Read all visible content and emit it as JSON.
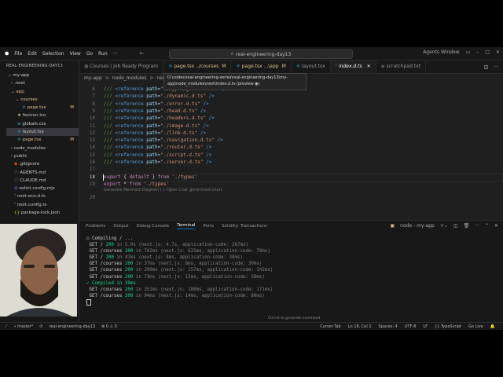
{
  "titlebar": {
    "menu": [
      "File",
      "Edit",
      "Selection",
      "View",
      "Go",
      "Run"
    ],
    "more": "···",
    "command_center": "real-engineering-day13",
    "agents": "Agents Window"
  },
  "sidebar": {
    "header": "REAL-ENGINEERING-DAY13",
    "items": [
      {
        "label": "my-app",
        "mod": ""
      },
      {
        "label": ".next",
        "mod": ""
      },
      {
        "label": "app",
        "mod": ""
      },
      {
        "label": "courses",
        "mod": ""
      },
      {
        "label": "page.tsx",
        "mod": "M"
      },
      {
        "label": "favicon.ico",
        "mod": ""
      },
      {
        "label": "globals.css",
        "mod": ""
      },
      {
        "label": "layout.tsx",
        "mod": ""
      },
      {
        "label": "page.tsx",
        "mod": "M"
      },
      {
        "label": "node_modules",
        "mod": ""
      },
      {
        "label": "public",
        "mod": ""
      },
      {
        "label": ".gitignore",
        "mod": ""
      },
      {
        "label": "AGENTS.md",
        "mod": ""
      },
      {
        "label": "CLAUDE.md",
        "mod": ""
      },
      {
        "label": "eslint.config.mjs",
        "mod": ""
      },
      {
        "label": "next-env.d.ts",
        "mod": ""
      },
      {
        "label": "next.config.ts",
        "mod": ""
      },
      {
        "label": "package-lock.json",
        "mod": ""
      }
    ]
  },
  "tabs": [
    {
      "label": "Courses | Job Ready Program",
      "mod": ""
    },
    {
      "label": "page.tsx ../courses",
      "mod": "M"
    },
    {
      "label": "page.tsx ...\\app",
      "mod": "M"
    },
    {
      "label": "layout.tsx",
      "mod": ""
    },
    {
      "label": "index.d.ts",
      "mod": ""
    },
    {
      "label": "scratchpad.txt",
      "mod": ""
    }
  ],
  "breadcrumb": [
    "my-app",
    ">",
    "node_modules",
    ">",
    "next",
    ">",
    "ty"
  ],
  "tooltip": "D:\\codes\\real-engineering-series\\real-engineering-day13\\my-app\\node_modules\\next\\index.d.ts (preview ◉)",
  "code": [
    {
      "n": "6",
      "path": "./types/global.d.ts"
    },
    {
      "n": "7",
      "path": "./dynamic.d.ts"
    },
    {
      "n": "8",
      "path": "./error.d.ts"
    },
    {
      "n": "9",
      "path": "./head.d.ts"
    },
    {
      "n": "10",
      "path": "./headers.d.ts"
    },
    {
      "n": "11",
      "path": "./image.d.ts"
    },
    {
      "n": "12",
      "path": "./link.d.ts"
    },
    {
      "n": "13",
      "path": "./navigation.d.ts"
    },
    {
      "n": "14",
      "path": "./router.d.ts"
    },
    {
      "n": "15",
      "path": "./script.d.ts"
    },
    {
      "n": "16",
      "path": "./server.d.ts"
    }
  ],
  "code_tail": {
    "l17": "17",
    "l18": "18",
    "l19": "19",
    "l20": "20",
    "export1_a": "export",
    "export1_b": " { ",
    "export1_c": "default",
    "export1_d": " } ",
    "export1_e": "from",
    "export1_f": " './types'",
    "export2_a": "export",
    "export2_b": " * ",
    "export2_c": "from",
    "export2_d": " './types'",
    "lens": "Generate Mermaid Diagram | ◇ Open Chat @mermaid-chart",
    "ref_kw": "/// ",
    "ref_tag": "<reference ",
    "ref_attr": "path=",
    "ref_end": " />"
  },
  "panel": {
    "tabs": [
      "Problems",
      "Output",
      "Debug Console",
      "Terminal",
      "Ports",
      "Solidity: Transactions"
    ],
    "active": "Terminal",
    "terminal_name": "node - my-app",
    "hint": "Ctrl+K to generate command"
  },
  "terminal": [
    {
      "pre": "○ Compiling / ...",
      "status": "",
      "rest": ""
    },
    {
      "pre": " GET / ",
      "status": "200",
      "rest": " in 5.0s (next.js: 4.7s, application-code: 287ms)"
    },
    {
      "pre": " GET /courses ",
      "status": "200",
      "rest": " in 702ms (next.js: 625ms, application-code: 78ms)"
    },
    {
      "pre": " GET / ",
      "status": "200",
      "rest": " in 47ms (next.js: 8ms, application-code: 38ms)"
    },
    {
      "pre": " GET /courses ",
      "status": "200",
      "rest": " in 37ms (next.js: 8ms, application-code: 30ms)"
    },
    {
      "pre": " GET /courses ",
      "status": "200",
      "rest": " in 299ms (next.js: 157ms, application-code: 142ms)"
    },
    {
      "pre": " GET /courses ",
      "status": "200",
      "rest": " in 73ms (next.js: 15ms, application-code: 58ms)"
    },
    {
      "pre": "✓ Compiled in 39ms",
      "status": "",
      "rest": ""
    },
    {
      "pre": " GET /courses ",
      "status": "200",
      "rest": " in 351ms (next.js: 180ms, application-code: 171ms)"
    },
    {
      "pre": " GET /courses ",
      "status": "200",
      "rest": " in 94ms (next.js: 14ms, application-code: 80ms)"
    }
  ],
  "statusbar": {
    "branch": "master*",
    "workspace": "real-engineering-day13",
    "problems": "⊗ 0 ⚠ 0",
    "right": [
      "Cursor Tab",
      "Ln 18, Col 1",
      "Spaces: 4",
      "UTF-8",
      "LF",
      "{} TypeScript",
      "Go Live"
    ]
  }
}
